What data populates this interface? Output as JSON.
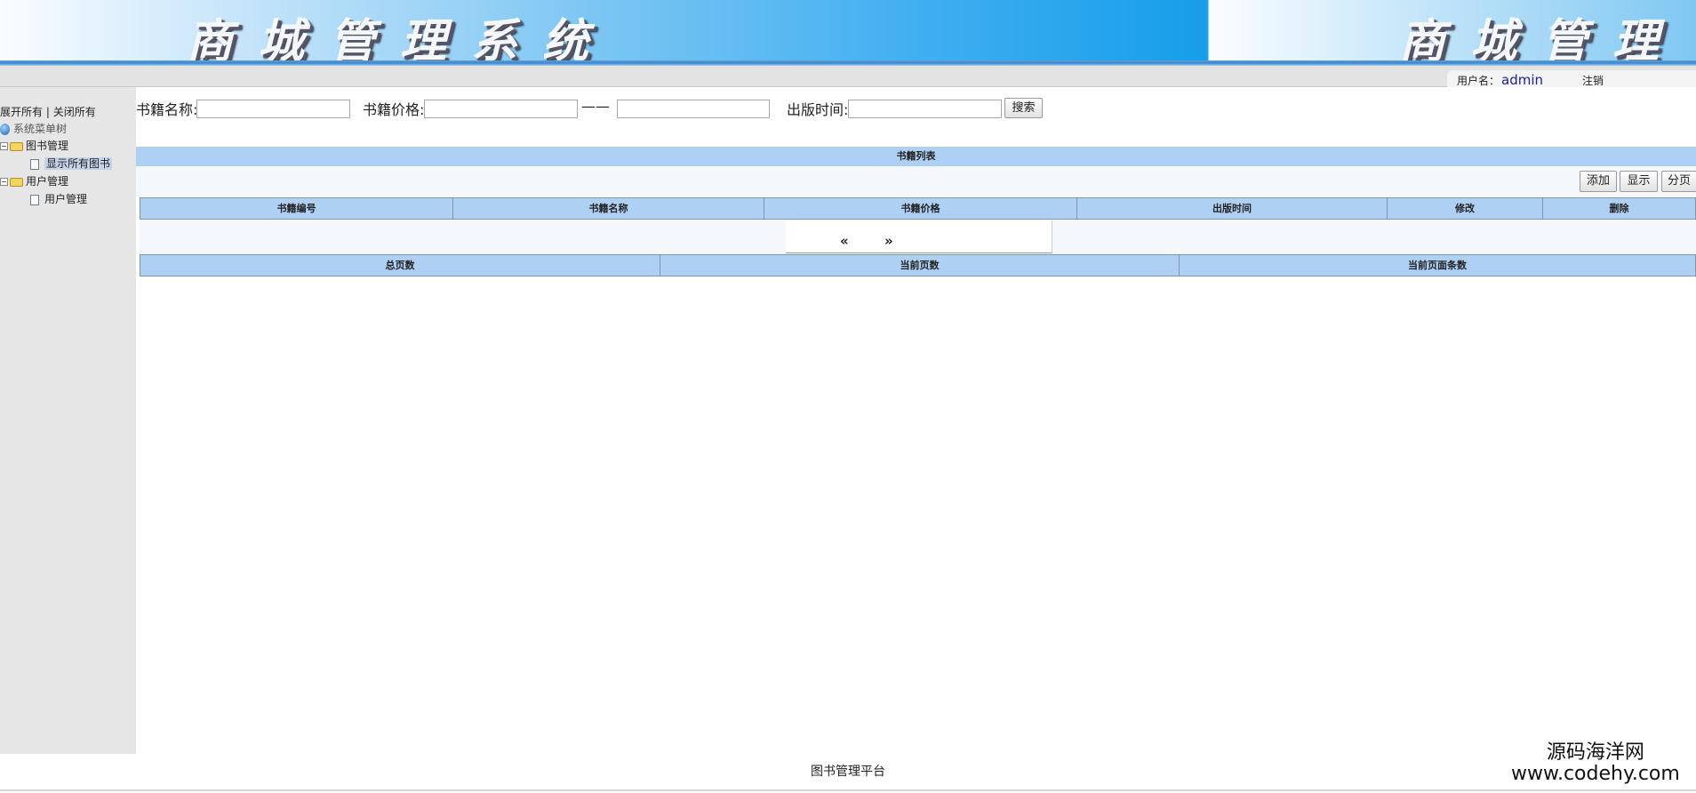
{
  "header": {
    "title": "商城管理系统",
    "title_repeat": "商城管理"
  },
  "userbar": {
    "user_label": "用户名：",
    "username": "admin",
    "logout": "注销"
  },
  "sidebar": {
    "expand_all": "展开所有",
    "separator": "|",
    "collapse_all": "关闭所有",
    "root": "系统菜单树",
    "groups": [
      {
        "label": "图书管理",
        "items": [
          {
            "label": "显示所有图书",
            "selected": true
          }
        ]
      },
      {
        "label": "用户管理",
        "items": [
          {
            "label": "用户管理",
            "selected": false
          }
        ]
      }
    ]
  },
  "search": {
    "name_label": "书籍名称:",
    "name_value": "",
    "price_label": "书籍价格:",
    "price_min": "",
    "price_sep": "——",
    "price_max": "",
    "date_label": "出版时间:",
    "date_value": "",
    "search_button": "搜索"
  },
  "table": {
    "title": "书籍列表",
    "buttons": [
      "添加",
      "显示",
      "分页"
    ],
    "columns": [
      "书籍编号",
      "书籍名称",
      "书籍价格",
      "出版时间",
      "修改",
      "删除"
    ],
    "pager": {
      "prev": "«",
      "next": "»"
    },
    "summary_columns": [
      "总页数",
      "当前页数",
      "当前页面条数"
    ]
  },
  "footer": {
    "text": "图书管理平台"
  },
  "watermark": {
    "line1": "源码海洋网",
    "line2": "www.codehy.com"
  }
}
